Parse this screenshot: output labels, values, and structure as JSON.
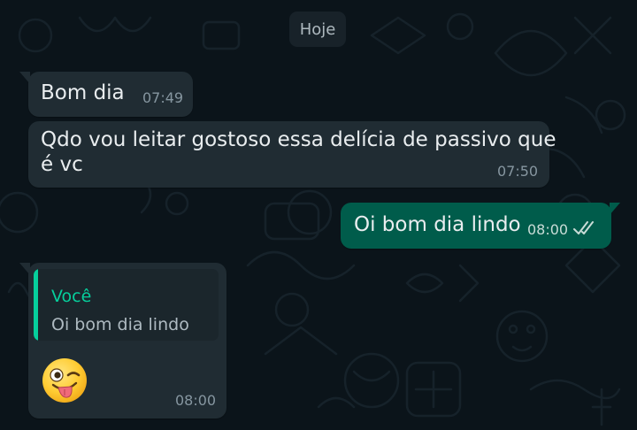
{
  "chat": {
    "date_chip": "Hoje",
    "messages": [
      {
        "direction": "incoming",
        "lines": [
          "Bom dia"
        ],
        "time": "07:49"
      },
      {
        "direction": "incoming",
        "lines": [
          "Qdo vou leitar gostoso essa delícia de passivo que",
          "é vc"
        ],
        "time": "07:50"
      },
      {
        "direction": "outgoing",
        "lines": [
          "Oi bom dia lindo"
        ],
        "time": "08:00",
        "status_icon": "double-check-icon"
      },
      {
        "direction": "incoming",
        "quote": {
          "author": "Você",
          "text": "Oi bom dia lindo"
        },
        "emoji_icon": "winking-face-with-tongue-icon",
        "time": "08:00"
      }
    ]
  },
  "colors": {
    "background": "#0b141a",
    "incoming_bubble": "#202c33",
    "outgoing_bubble": "#005c4b",
    "quote_accent": "#06cf9c",
    "text": "#e9edef",
    "meta_text": "#8696a0"
  }
}
